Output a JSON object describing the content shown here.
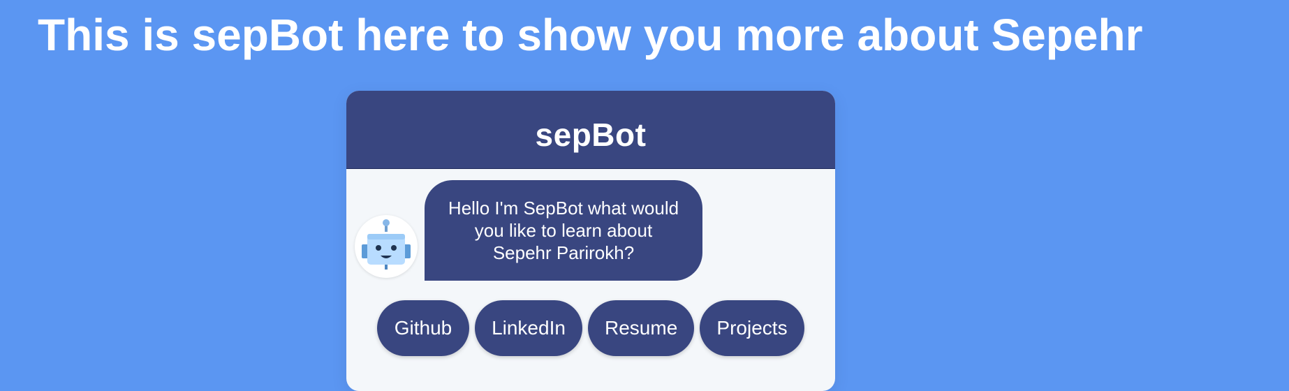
{
  "page": {
    "heading": "This is sepBot here to show you more about Sepehr"
  },
  "chatbot": {
    "title": "sepBot",
    "avatar_icon": "robot-icon",
    "message": "Hello I'm SepBot what would you like to learn about Sepehr Parirokh?",
    "options": [
      "Github",
      "LinkedIn",
      "Resume",
      "Projects"
    ]
  },
  "colors": {
    "background": "#5b96f2",
    "accent": "#394680",
    "chat_surface": "#f4f7fa",
    "text_light": "#ffffff"
  }
}
